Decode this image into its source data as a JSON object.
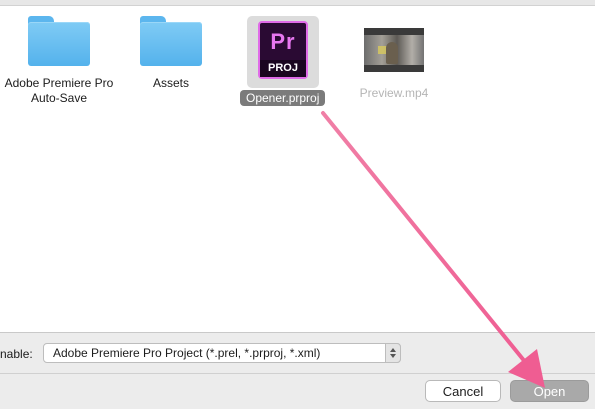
{
  "files": [
    {
      "name": "Adobe Premiere Pro Auto-Save",
      "kind": "folder",
      "selected": false,
      "dimmed": false
    },
    {
      "name": "Assets",
      "kind": "folder",
      "selected": false,
      "dimmed": false
    },
    {
      "name": "Opener.prproj",
      "kind": "premiere-project",
      "selected": true,
      "dimmed": false,
      "icon_text": "Pr",
      "icon_sub": "PROJ"
    },
    {
      "name": "Preview.mp4",
      "kind": "video",
      "selected": false,
      "dimmed": true
    }
  ],
  "footer": {
    "enable_label": "nable:",
    "file_type_value": "Adobe Premiere Pro Project (*.prel, *.prproj, *.xml)",
    "cancel_label": "Cancel",
    "open_label": "Open"
  },
  "colors": {
    "folder": "#5cb6ee",
    "premiere_accent": "#e06be8",
    "annotation_arrow": "#f0699b",
    "selection_label": "#7b7b7b"
  },
  "annotation": {
    "type": "arrow",
    "from": "Opener.prproj",
    "to": "Open"
  }
}
